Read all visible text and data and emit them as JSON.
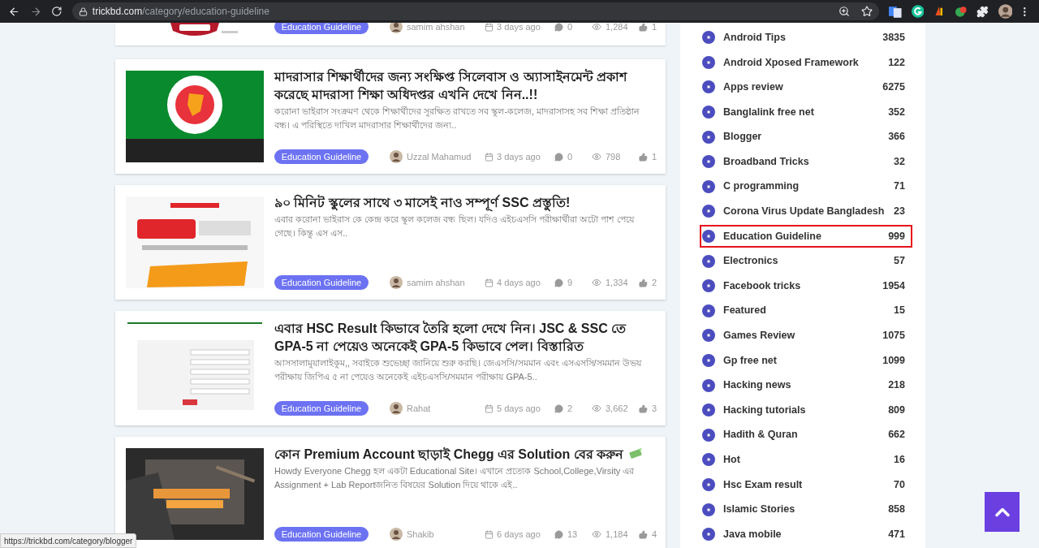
{
  "browser": {
    "url_host": "trickbd.com",
    "url_path": "/category/education-guideline"
  },
  "posts": [
    {
      "kind": "cut",
      "tag": "Education Guideline",
      "author": "samim ahshan",
      "date": "3 days ago",
      "comments": "0",
      "views": "1,284",
      "likes": "1"
    },
    {
      "kind": "full",
      "title": "মাদরাসার শিক্ষার্থীদের জন্য সংক্ষিপ্ত সিলেবাস ও অ্যাসাইনমেন্ট প্রকাশ করেছে মাদরাসা শিক্ষা অধিদপ্তর এখনি দেখে নিন..!!",
      "excerpt": "করোনা ভাইরাস সংক্রমণ থেকে শিক্ষার্থীদের সুরক্ষিত রাখতে সব স্কুল-কলেজ, মাদরাসাসহ সব শিক্ষা প্রতিষ্ঠান বন্ধ। এ পরিস্থিতে দাখিল মাদরাসার শিক্ষার্থীদের জন্য..",
      "tag": "Education Guideline",
      "author": "Uzzal Mahamud",
      "date": "3 days ago",
      "comments": "0",
      "views": "798",
      "likes": "1"
    },
    {
      "kind": "full",
      "title": "৯০ মিনিট স্কুলের সাথে ৩ মাসেই নাও সম্পূর্ণ SSC প্রস্তুতি!",
      "excerpt": "এবার করোনা ভাইরাস কে কেন্দ্র করে স্কুল কলেজ বন্ধ ছিল। যদিও এইচএসসি পরীক্ষার্থীরা অটো পাশ পেয়ে গেছে। কিন্তু এস এস..",
      "tag": "Education Guideline",
      "author": "samim ahshan",
      "date": "4 days ago",
      "comments": "9",
      "views": "1,334",
      "likes": "2"
    },
    {
      "kind": "full",
      "title": "এবার HSC Result কিভাবে তৈরি হলো দেখে নিন। JSC & SSC তে GPA-5 না পেয়েও অনেকেই GPA-5 কিভাবে পেল। বিস্তারিত",
      "excerpt": "আসসালামুয়ালাইকুম,, সবাইকে শুভেচ্ছা জানিয়ে শুরু করছি। জেএসসি/সমমান এবং এসএসসি/সমমান উভয় পরীক্ষায় জিপিএ ৫ না পেয়েও অনেকেই এইচএসসি/সমমান পরীক্ষায় GPA-5..",
      "tag": "Education Guideline",
      "author": "Rahat",
      "date": "5 days ago",
      "comments": "2",
      "views": "3,662",
      "likes": "3"
    },
    {
      "kind": "full",
      "title": "কোন Premium Account ছাড়াই Chegg এর Solution বের করুন",
      "excerpt": "Howdy Everyone Chegg হল একটা Educational Site। এখানে প্রত্যেক School,College,Virsity এর Assignment + Lab Reportজনিত বিষয়ের Solution দিয়ে থাকে এই..",
      "tag": "Education Guideline",
      "author": "Shakib",
      "date": "6 days ago",
      "comments": "13",
      "views": "1,184",
      "likes": "4"
    }
  ],
  "categories": [
    {
      "name": "Android Tips",
      "count": "3835",
      "selected": false
    },
    {
      "name": "Android Xposed Framework",
      "count": "122",
      "selected": false
    },
    {
      "name": "Apps review",
      "count": "6275",
      "selected": false
    },
    {
      "name": "Banglalink free net",
      "count": "352",
      "selected": false
    },
    {
      "name": "Blogger",
      "count": "366",
      "selected": false
    },
    {
      "name": "Broadband Tricks",
      "count": "32",
      "selected": false
    },
    {
      "name": "C programming",
      "count": "71",
      "selected": false
    },
    {
      "name": "Corona Virus Update Bangladesh",
      "count": "23",
      "selected": false
    },
    {
      "name": "Education Guideline",
      "count": "999",
      "selected": true
    },
    {
      "name": "Electronics",
      "count": "57",
      "selected": false
    },
    {
      "name": "Facebook tricks",
      "count": "1954",
      "selected": false
    },
    {
      "name": "Featured",
      "count": "15",
      "selected": false
    },
    {
      "name": "Games Review",
      "count": "1075",
      "selected": false
    },
    {
      "name": "Gp free net",
      "count": "1099",
      "selected": false
    },
    {
      "name": "Hacking news",
      "count": "218",
      "selected": false
    },
    {
      "name": "Hacking tutorials",
      "count": "809",
      "selected": false
    },
    {
      "name": "Hadith & Quran",
      "count": "662",
      "selected": false
    },
    {
      "name": "Hot",
      "count": "16",
      "selected": false
    },
    {
      "name": "Hsc Exam result",
      "count": "70",
      "selected": false
    },
    {
      "name": "Islamic Stories",
      "count": "858",
      "selected": false
    },
    {
      "name": "Java mobile",
      "count": "471",
      "selected": false
    }
  ],
  "status_url": "https://trickbd.com/category/blogger"
}
